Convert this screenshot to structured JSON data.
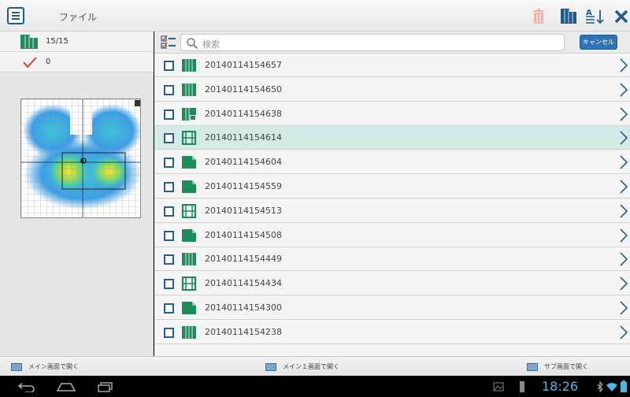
{
  "header": {
    "title": "ファイル"
  },
  "left_panel": {
    "count_label": "15/15",
    "selected_count": "0"
  },
  "search": {
    "placeholder": "検索",
    "cancel_label": "キャンセル"
  },
  "files": [
    {
      "name": "20140114154657",
      "type": "data",
      "selected": false
    },
    {
      "name": "20140114154650",
      "type": "data",
      "selected": false
    },
    {
      "name": "20140114154638",
      "type": "jpg",
      "selected": false
    },
    {
      "name": "20140114154614",
      "type": "video",
      "selected": true
    },
    {
      "name": "20140114154604",
      "type": "image",
      "selected": false
    },
    {
      "name": "20140114154559",
      "type": "image",
      "selected": false
    },
    {
      "name": "20140114154513",
      "type": "video",
      "selected": false
    },
    {
      "name": "20140114154508",
      "type": "image",
      "selected": false
    },
    {
      "name": "20140114154449",
      "type": "data",
      "selected": false
    },
    {
      "name": "20140114154434",
      "type": "video",
      "selected": false
    },
    {
      "name": "20140114154300",
      "type": "image",
      "selected": false
    },
    {
      "name": "20140114154238",
      "type": "data",
      "selected": false
    }
  ],
  "action_bar": {
    "open_main": "メイン画面で開く",
    "open_main1": "メイン１画面で開く",
    "open_sub": "サブ画面で開く"
  },
  "status": {
    "time": "18:26"
  },
  "colors": {
    "accent": "#2f73b5",
    "icon_green": "#1f8a5a",
    "selected_row": "#d5ece6",
    "clock": "#4db6e8"
  }
}
